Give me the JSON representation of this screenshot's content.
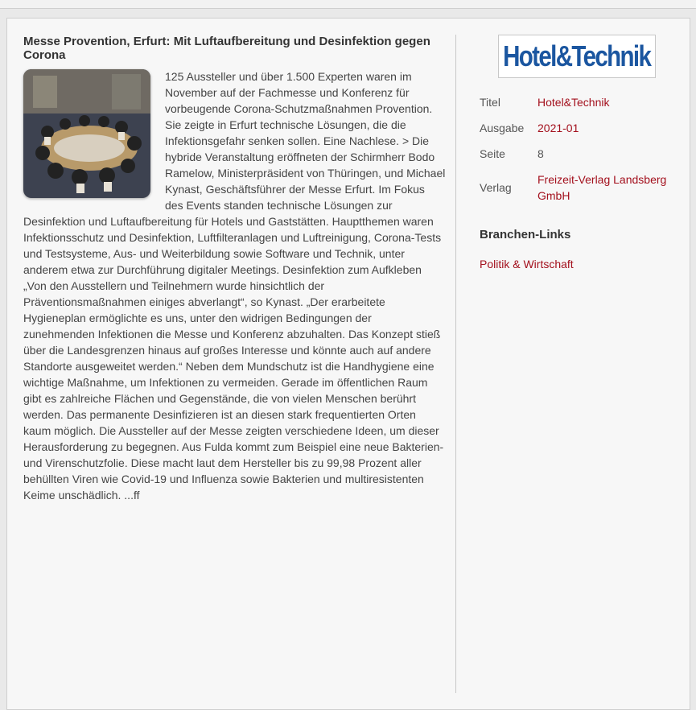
{
  "article": {
    "title": "Messe Provention, Erfurt: Mit Luftaufbereitung und Desinfektion gegen Corona",
    "body": "125 Aussteller und über 1.500 Experten waren im November auf der Fachmesse und Konferenz für vorbeugende Corona-Schutzmaßnahmen Provention. Sie zeigte in Erfurt technische Lösungen, die die Infektionsgefahr senken sollen. Eine Nachlese. > Die hybride Veranstaltung eröffneten der Schirmherr Bodo Ramelow, Ministerpräsident von Thüringen, und Michael Kynast, Geschäftsführer der Messe Erfurt. Im Fokus des Events standen technische Lösungen zur Desinfektion und Luftaufbereitung für Hotels und Gaststätten. Hauptthemen waren Infektionsschutz und Desinfektion, Luftfilteranlagen und Luftreinigung, Corona-Tests und Testsysteme, Aus- und Weiterbildung sowie Software und Technik, unter anderem etwa zur Durchführung digitaler Meetings. Desinfektion zum Aufkleben „Von den Ausstellern und Teilnehmern wurde hinsichtlich der Präventionsmaßnahmen einiges abverlangt“, so Kynast. „Der erarbeitete Hygieneplan ermöglichte es uns, unter den widrigen Bedingungen der zunehmenden Infektionen die Messe und Konferenz abzuhalten. Das Konzept stieß über die Landesgrenzen hinaus auf großes Interesse und könnte auch auf andere Standorte ausgeweitet werden.“ Neben dem Mundschutz ist die Handhygiene eine wichtige Maßnahme, um Infektionen zu vermeiden. Gerade im öffentlichen Raum gibt es zahlreiche Flächen und Gegenstände, die von vielen Menschen berührt werden. Das permanente Desinfizieren ist an diesen stark frequentierten Orten kaum möglich. Die Aussteller auf der Messe zeigten verschiedene Ideen, um dieser Herausforderung zu begegnen. Aus Fulda kommt zum Beispiel eine neue Bakterien- und Virenschutzfolie. Diese macht laut dem Hersteller bis zu 99,98 Prozent aller behüllten Viren wie Covid-19 und Influenza sowie Bakterien und multiresistenten Keime unschädlich. ...ff"
  },
  "sidebar": {
    "logo_text": "Hotel&Technik",
    "logo_color": "#1b56a0",
    "meta": [
      {
        "label": "Titel",
        "value": "Hotel&Technik"
      },
      {
        "label": "Ausgabe",
        "value": "2021-01"
      },
      {
        "label": "Seite",
        "value": "8"
      },
      {
        "label": "Verlag",
        "value": "Freizeit-Verlag Landsberg GmbH"
      }
    ],
    "links_heading": "Branchen-Links",
    "links": [
      "Politik & Wirtschaft"
    ]
  },
  "colors": {
    "link": "#a3101d",
    "background": "#f7f7f7"
  }
}
